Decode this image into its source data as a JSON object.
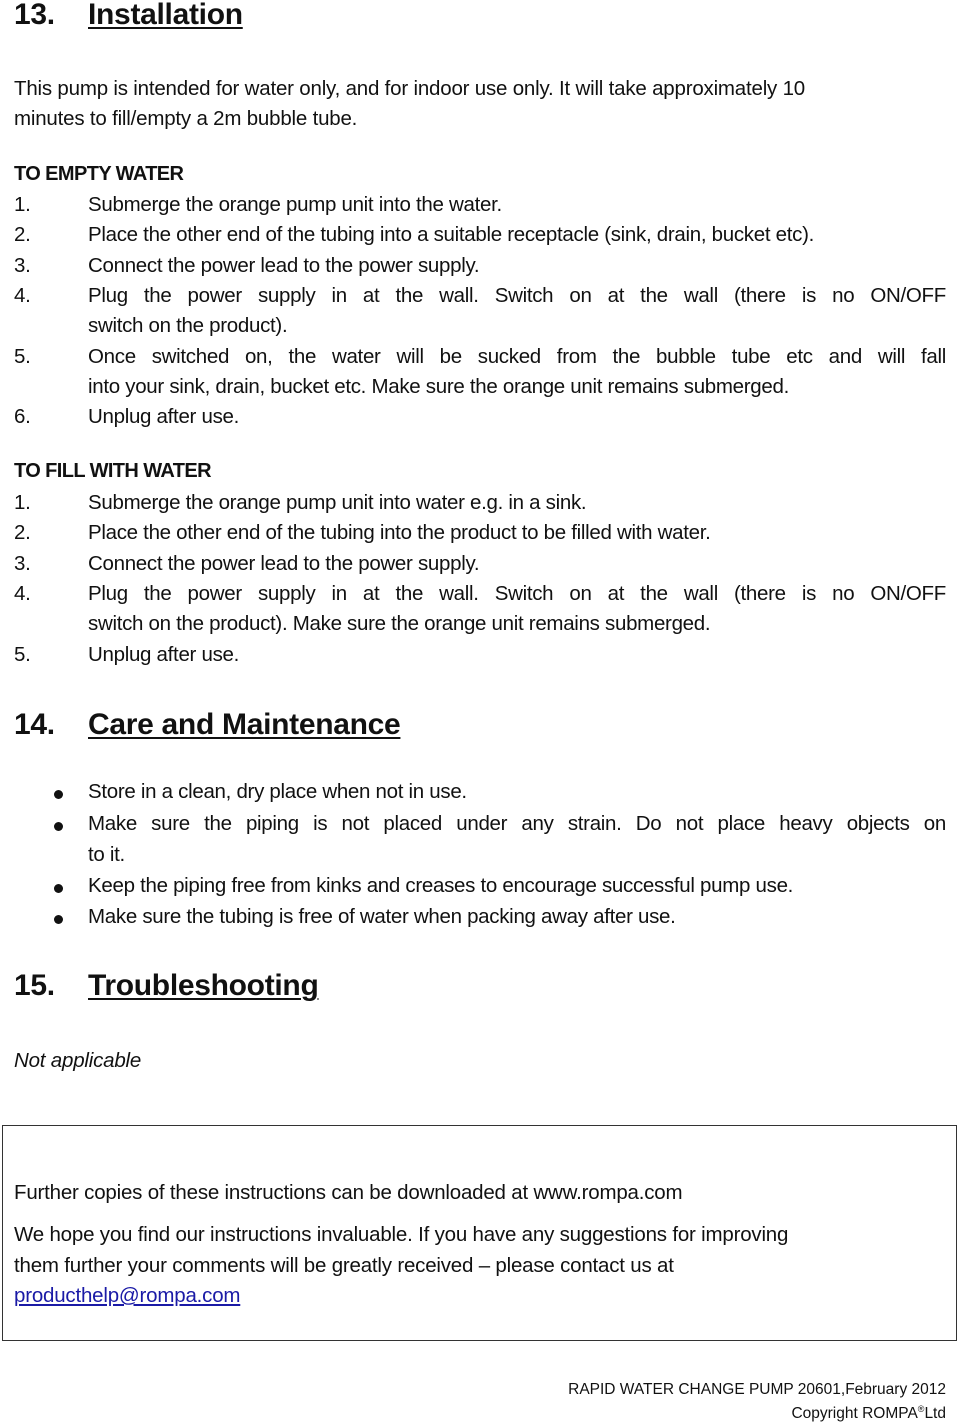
{
  "sections": {
    "installation": {
      "number": "13.",
      "title": "Installation",
      "intro_line1": "This pump is intended for water only, and for indoor use only.  It will take approximately 10",
      "intro_line2": "minutes to fill/empty a 2m bubble tube.",
      "empty": {
        "heading": "TO EMPTY WATER",
        "steps": [
          {
            "n": "1.",
            "lines": [
              "Submerge the orange pump unit into the water."
            ]
          },
          {
            "n": "2.",
            "lines": [
              "Place the other end of the tubing into a suitable receptacle (sink, drain, bucket etc)."
            ]
          },
          {
            "n": "3.",
            "lines": [
              "Connect the power lead to the power supply."
            ]
          },
          {
            "n": "4.",
            "lines": [
              "Plug the power supply in at the wall.  Switch on at the wall (there is no ON/OFF",
              "switch on the product)."
            ]
          },
          {
            "n": "5.",
            "lines": [
              "Once switched on, the water will be sucked from the bubble tube etc and will fall",
              "into your sink, drain, bucket etc.  Make sure the orange unit remains submerged."
            ]
          },
          {
            "n": "6.",
            "lines": [
              "Unplug after use."
            ]
          }
        ]
      },
      "fill": {
        "heading": "TO FILL WITH WATER",
        "steps": [
          {
            "n": "1.",
            "lines": [
              "Submerge the orange pump unit into water e.g. in a sink."
            ]
          },
          {
            "n": "2.",
            "lines": [
              "Place the other end of the tubing into the product to be filled with water."
            ]
          },
          {
            "n": "3.",
            "lines": [
              "Connect the power lead to the power supply."
            ]
          },
          {
            "n": "4.",
            "lines": [
              "Plug the power supply in at the wall.  Switch on at the wall (there is no ON/OFF",
              "switch on the product).  Make sure the orange unit remains submerged."
            ]
          },
          {
            "n": "5.",
            "lines": [
              "Unplug after use."
            ]
          }
        ]
      }
    },
    "care": {
      "number": "14.",
      "title": "Care and Maintenance",
      "bullets": [
        {
          "lines": [
            "Store in a clean, dry place when not in use."
          ]
        },
        {
          "lines": [
            "Make sure the piping is not placed under any strain.  Do not place heavy objects on",
            "to it."
          ]
        },
        {
          "lines": [
            "Keep the piping free from kinks and creases to encourage successful pump use."
          ]
        },
        {
          "lines": [
            "Make sure the tubing is free of water when packing away after use."
          ]
        }
      ]
    },
    "troubleshooting": {
      "number": "15.",
      "title": "Troubleshooting",
      "body": "Not applicable"
    }
  },
  "notice_box": {
    "line1": "Further copies of these instructions can be downloaded at www.rompa.com",
    "line2": "We hope you find our instructions invaluable.  If you have any suggestions for improving",
    "line3": "them further your comments will be greatly received – please contact us at",
    "email": "producthelp@rompa.com"
  },
  "footer": {
    "line1": "RAPID WATER CHANGE PUMP 20601,February 2012",
    "copyright_prefix": "Copyright ROMPA",
    "registered_mark": "®",
    "copyright_suffix": "Ltd"
  },
  "colors": {
    "text": "#111111",
    "link": "#1a1aa6"
  }
}
